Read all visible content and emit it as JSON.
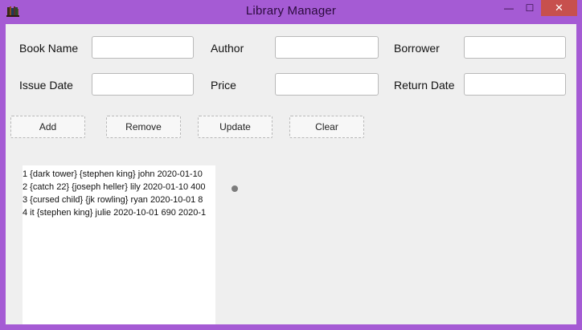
{
  "window": {
    "title": "Library Manager",
    "icon": "books-icon",
    "controls": {
      "minimize": "—",
      "maximize": "☐",
      "close": "✕"
    },
    "colors": {
      "frame": "#a55bd4",
      "close": "#c7504d",
      "client": "#efefef"
    }
  },
  "form": {
    "book_name_label": "Book Name",
    "author_label": "Author",
    "borrower_label": "Borrower",
    "issue_date_label": "Issue Date",
    "price_label": "Price",
    "return_date_label": "Return Date",
    "book_name_value": "",
    "author_value": "",
    "borrower_value": "",
    "issue_date_value": "",
    "price_value": "",
    "return_date_value": ""
  },
  "buttons": {
    "add": "Add",
    "remove": "Remove",
    "update": "Update",
    "clear": "Clear"
  },
  "list": {
    "items": [
      "1 {dark tower} {stephen king} john 2020-01-10",
      "2 {catch 22} {joseph heller} lily 2020-01-10 400",
      "3 {cursed child} {jk rowling} ryan 2020-10-01 8",
      "4 it {stephen king} julie 2020-10-01 690 2020-1"
    ]
  }
}
